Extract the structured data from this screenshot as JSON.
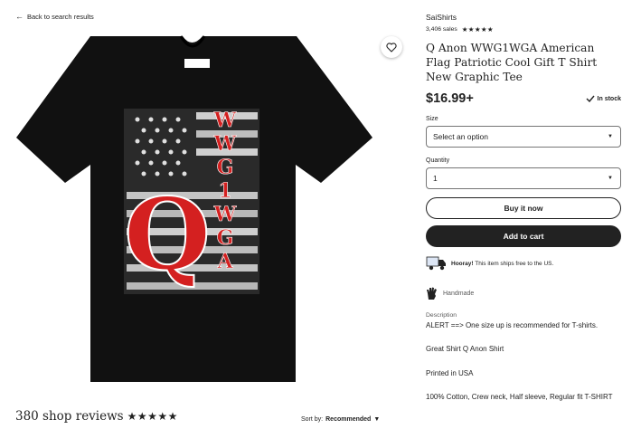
{
  "nav": {
    "back_label": "Back to search results"
  },
  "shop": {
    "name": "SaiShirts",
    "sales": "3,406 sales",
    "rating_stars": "★★★★★"
  },
  "product": {
    "title": "Q Anon WWG1WGA American Flag Patriotic Cool Gift T Shirt New Graphic Tee",
    "price": "$16.99+",
    "stock": "In stock",
    "image": {
      "shirt_letter": "Q",
      "vertical_text": [
        "W",
        "W",
        "G",
        "1",
        "W",
        "G",
        "A"
      ],
      "shirt_color": "#111111",
      "accent_color": "#d42020"
    }
  },
  "size": {
    "label": "Size",
    "value": "Select an option"
  },
  "quantity": {
    "label": "Quantity",
    "value": "1"
  },
  "actions": {
    "buy_now": "Buy it now",
    "add_to_cart": "Add to cart"
  },
  "shipping": {
    "bold": "Hooray!",
    "text": " This item ships free to the US."
  },
  "handmade": {
    "label": "Handmade"
  },
  "description": {
    "label": "Description",
    "lines": [
      "ALERT ==> One size up is recommended for T-shirts.",
      "Great Shirt Q Anon Shirt",
      "Printed in USA",
      "100% Cotton, Crew neck, Half sleeve, Regular fit T-SHIRT"
    ]
  },
  "reviews": {
    "title": "380 shop reviews",
    "stars": "★★★★★",
    "sort_label": "Sort by:",
    "sort_value": "Recommended"
  }
}
